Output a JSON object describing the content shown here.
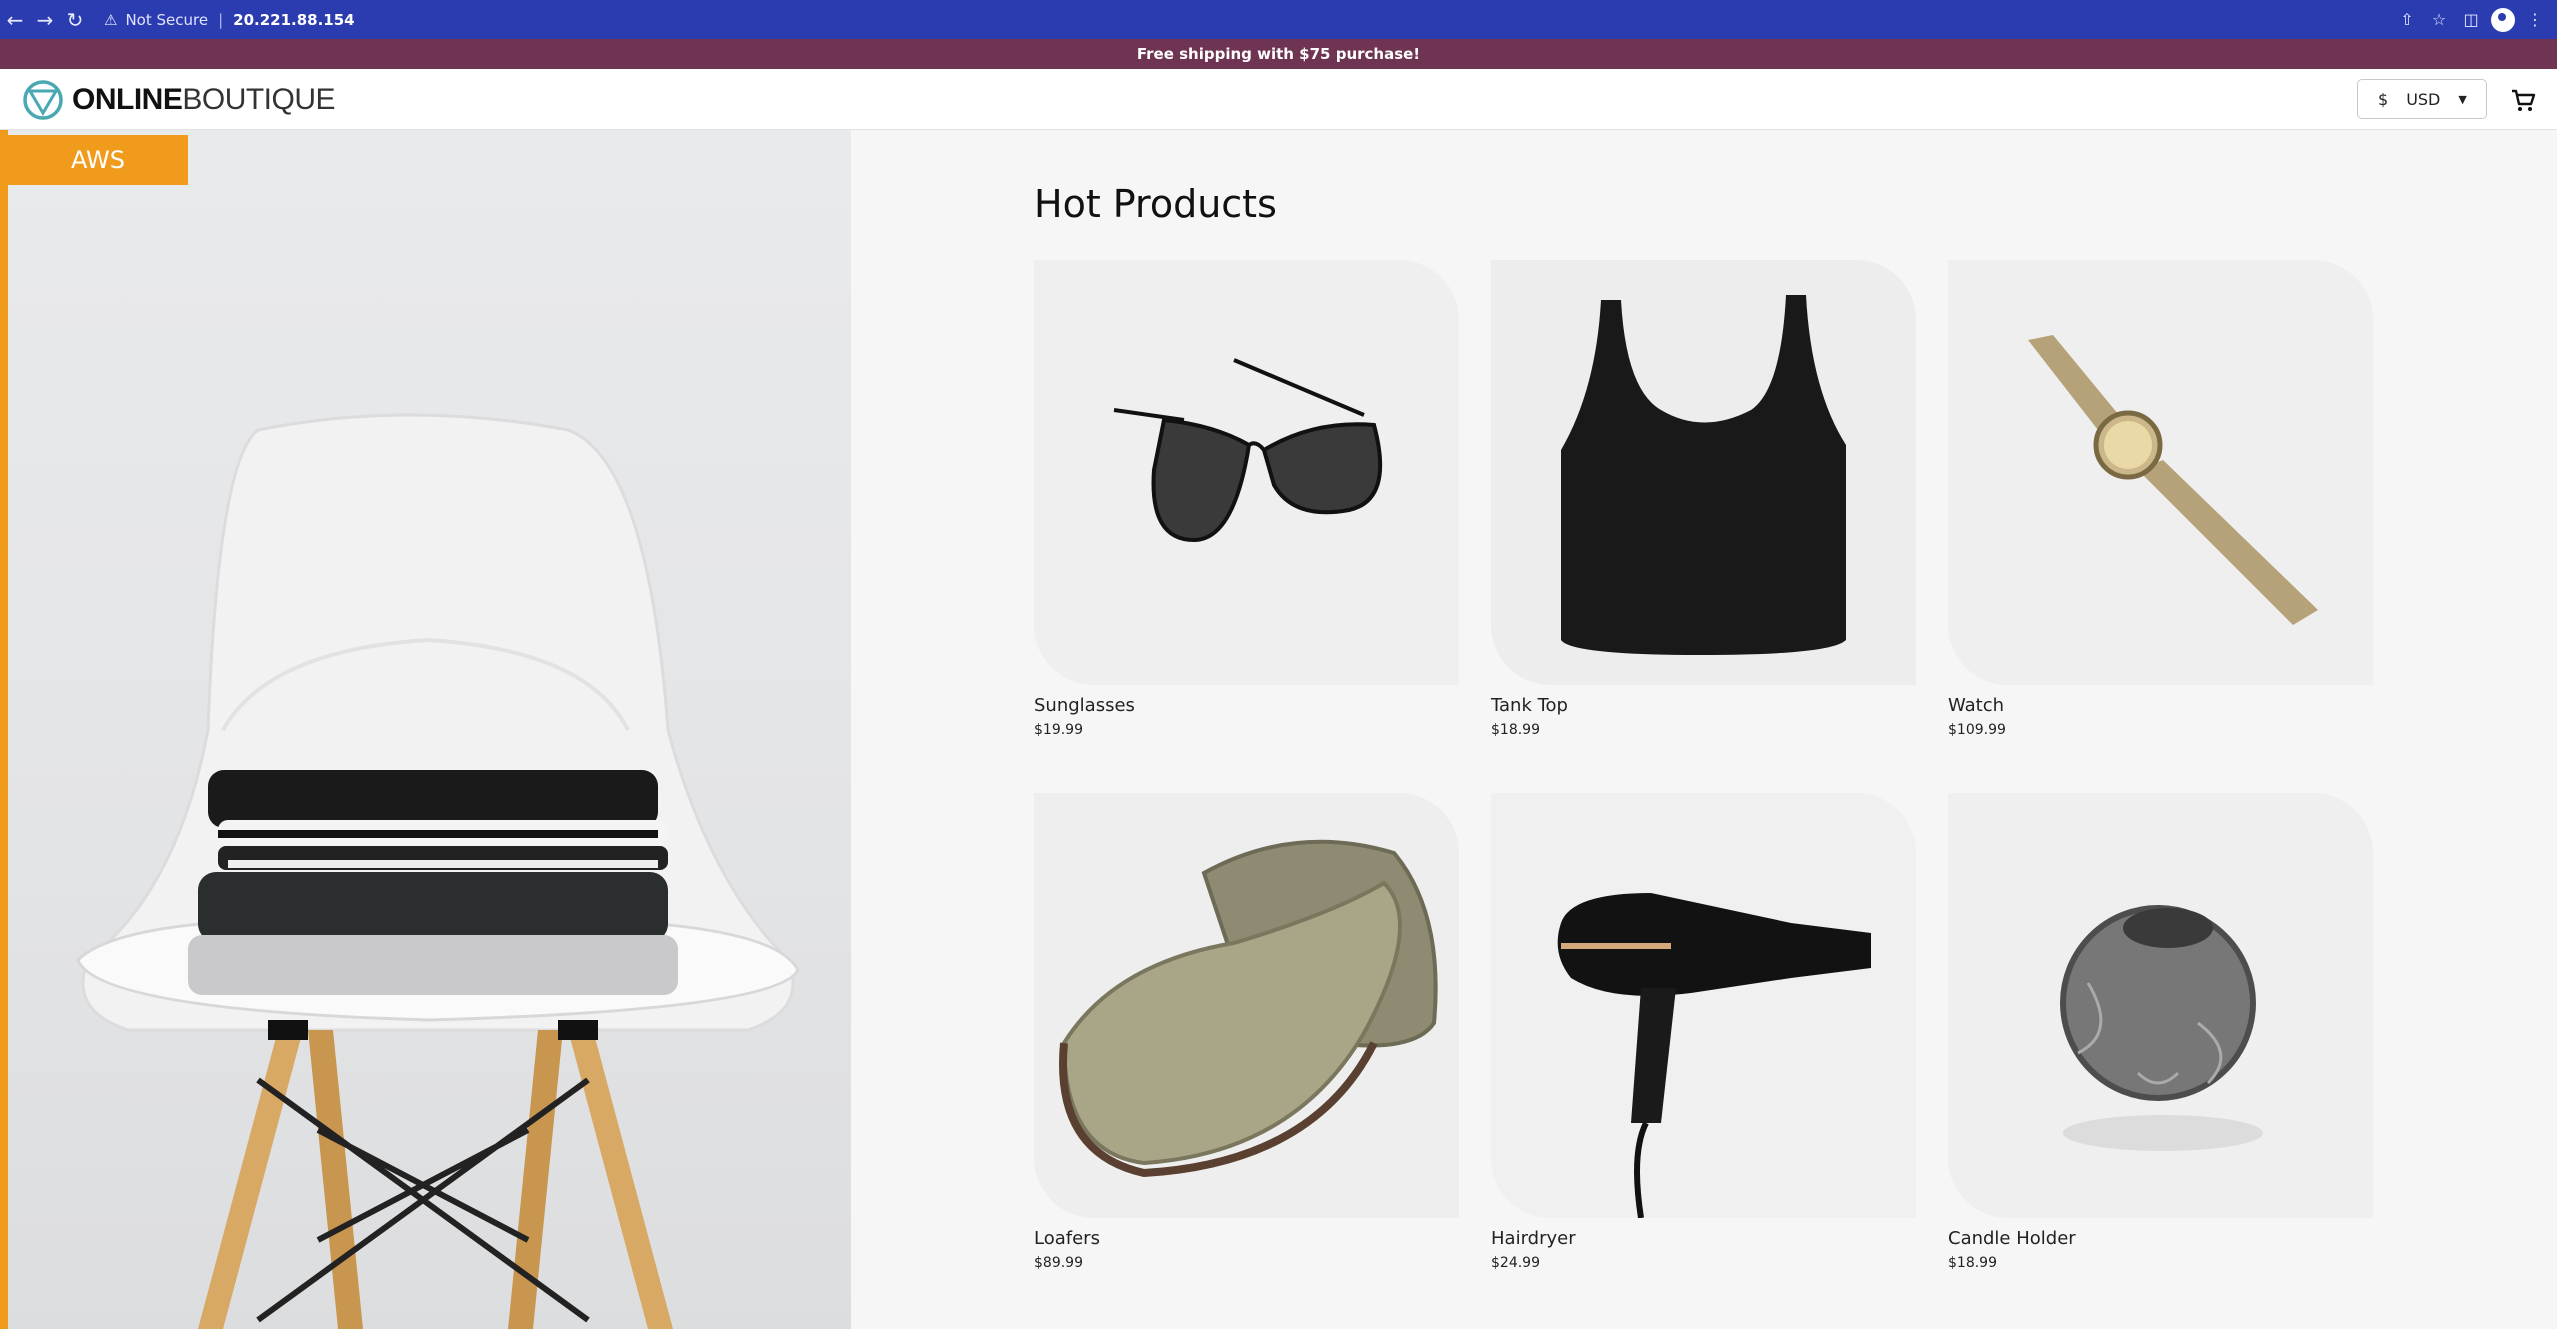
{
  "browser": {
    "security_label": "Not Secure",
    "address": "20.221.88.154"
  },
  "promo": {
    "text": "Free shipping with $75 purchase!"
  },
  "header": {
    "logo_bold": "ONLINE",
    "logo_light": "BOUTIQUE",
    "currency_symbol": "$",
    "currency_code": "USD"
  },
  "hero": {
    "badge": "AWS"
  },
  "main": {
    "title": "Hot Products",
    "products": [
      {
        "name": "Sunglasses",
        "price": "$19.99",
        "icon": "sunglasses-image"
      },
      {
        "name": "Tank Top",
        "price": "$18.99",
        "icon": "tank-top-image"
      },
      {
        "name": "Watch",
        "price": "$109.99",
        "icon": "watch-image"
      },
      {
        "name": "Loafers",
        "price": "$89.99",
        "icon": "loafers-image"
      },
      {
        "name": "Hairdryer",
        "price": "$24.99",
        "icon": "hairdryer-image"
      },
      {
        "name": "Candle Holder",
        "price": "$18.99",
        "icon": "candle-holder-image"
      }
    ]
  },
  "colors": {
    "chrome": "#2a3cb0",
    "promo": "#6e3451",
    "accent": "#f09b1c"
  }
}
